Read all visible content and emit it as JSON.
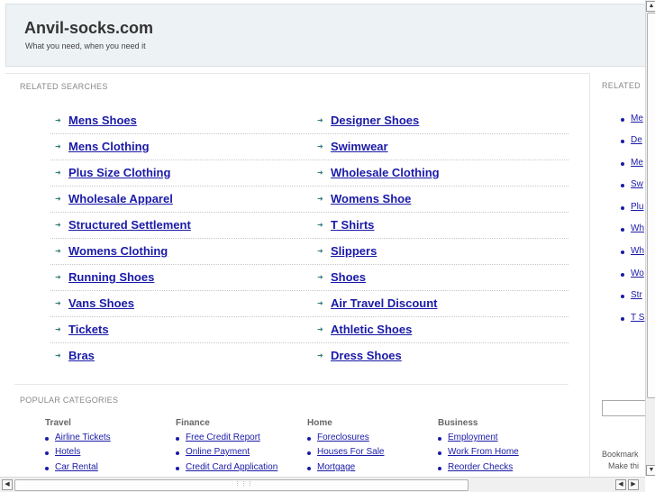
{
  "header": {
    "title": "Anvil-socks.com",
    "tagline": "What you need, when you need it"
  },
  "related": {
    "label": "RELATED SEARCHES",
    "left": [
      "Mens Shoes",
      "Mens Clothing",
      "Plus Size Clothing",
      "Wholesale Apparel",
      "Structured Settlement",
      "Womens Clothing",
      "Running Shoes",
      "Vans Shoes",
      "Tickets",
      "Bras"
    ],
    "right": [
      "Designer Shoes",
      "Swimwear",
      "Wholesale Clothing",
      "Womens Shoe",
      "T Shirts",
      "Slippers",
      "Shoes",
      "Air Travel Discount",
      "Athletic Shoes",
      "Dress Shoes"
    ]
  },
  "popular": {
    "label": "POPULAR CATEGORIES",
    "categories": [
      {
        "title": "Travel",
        "items": [
          "Airline Tickets",
          "Hotels",
          "Car Rental"
        ]
      },
      {
        "title": "Finance",
        "items": [
          "Free Credit Report",
          "Online Payment",
          "Credit Card Application"
        ]
      },
      {
        "title": "Home",
        "items": [
          "Foreclosures",
          "Houses For Sale",
          "Mortgage"
        ]
      },
      {
        "title": "Business",
        "items": [
          "Employment",
          "Work From Home",
          "Reorder Checks"
        ]
      }
    ]
  },
  "sidebar": {
    "label": "RELATED",
    "items": [
      "Me",
      "De",
      "Me",
      "Sw",
      "Plu",
      "Wh",
      "Wh",
      "Wo",
      "Str",
      "T S"
    ],
    "bookmark_line1": "Bookmark",
    "bookmark_line2": "Make thi"
  },
  "icons": {
    "arrow": "arrow-right-icon",
    "bullet": "bullet-icon"
  }
}
